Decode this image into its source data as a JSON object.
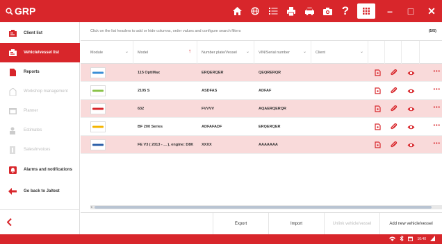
{
  "app": {
    "title": "GRP"
  },
  "titlebar": {
    "icons": [
      "home-icon",
      "globe-icon",
      "list-icon",
      "print-icon",
      "car-icon",
      "camera-icon",
      "help-icon",
      "apps-grid-icon"
    ],
    "help_label": "?",
    "window_buttons": {
      "minimize": "–",
      "maximize": "□",
      "close": "✕"
    }
  },
  "sidebar": {
    "items": [
      {
        "label": "Client list",
        "icon": "client-list-icon",
        "active": false,
        "disabled": false
      },
      {
        "label": "Vehicle/vessel list",
        "icon": "vehicle-list-icon",
        "active": true,
        "disabled": false
      },
      {
        "label": "Reports",
        "icon": "reports-icon",
        "active": false,
        "disabled": false
      },
      {
        "label": "Workshop management",
        "icon": "workshop-icon",
        "active": false,
        "disabled": true
      },
      {
        "label": "Planner",
        "icon": "planner-icon",
        "active": false,
        "disabled": true
      },
      {
        "label": "Estimates",
        "icon": "estimates-icon",
        "active": false,
        "disabled": true
      },
      {
        "label": "Sales/invoices",
        "icon": "invoices-icon",
        "active": false,
        "disabled": true
      },
      {
        "label": "Alarms and notifications",
        "icon": "alarm-icon",
        "active": false,
        "disabled": false
      },
      {
        "label": "Go back to Jaltest",
        "icon": "arrow-left-icon",
        "active": false,
        "disabled": false
      }
    ],
    "back_icon": "chevron-left-icon"
  },
  "main": {
    "hint": "Click on the list headers to add or hide columns, order values and configure search filters",
    "count": "(5/5)",
    "columns": [
      {
        "label": "Module",
        "chevron": true
      },
      {
        "label": "Model",
        "sort": "↑"
      },
      {
        "label": "Number plate/Vessel",
        "chevron": true
      },
      {
        "label": "VIN/Serial number",
        "chevron": true
      },
      {
        "label": "Client",
        "chevron": true
      }
    ],
    "rows": [
      {
        "model": "115 OptiMax",
        "plate": "ERQERQER",
        "vin": "QEQRERQR",
        "logo_color": "#3b8fd6"
      },
      {
        "model": "2105 S",
        "plate": "ASDFAS",
        "vin": "ADFAF",
        "logo_color": "#8bc34a"
      },
      {
        "model": "632",
        "plate": "FVVVV",
        "vin": "AQAERQERQR",
        "logo_color": "#d8262b"
      },
      {
        "model": "BF 200 Series",
        "plate": "ADFAFADF",
        "vin": "ERQERQER",
        "logo_color": "#f4b400"
      },
      {
        "model": "FE V3 ( 2013 - ... ), engine: D8K",
        "plate": "XXXX",
        "vin": "AAAAAAA",
        "logo_color": "#2a5fa8"
      }
    ]
  },
  "bottom_buttons": {
    "export": "Export",
    "import": "Import",
    "disabled": "Unlink vehicle/vessel",
    "add": "Add new vehicle/vessel"
  },
  "statusbar": {
    "time": "10:40"
  },
  "colors": {
    "accent": "#d8262b",
    "row_highlight": "#f9dada"
  }
}
